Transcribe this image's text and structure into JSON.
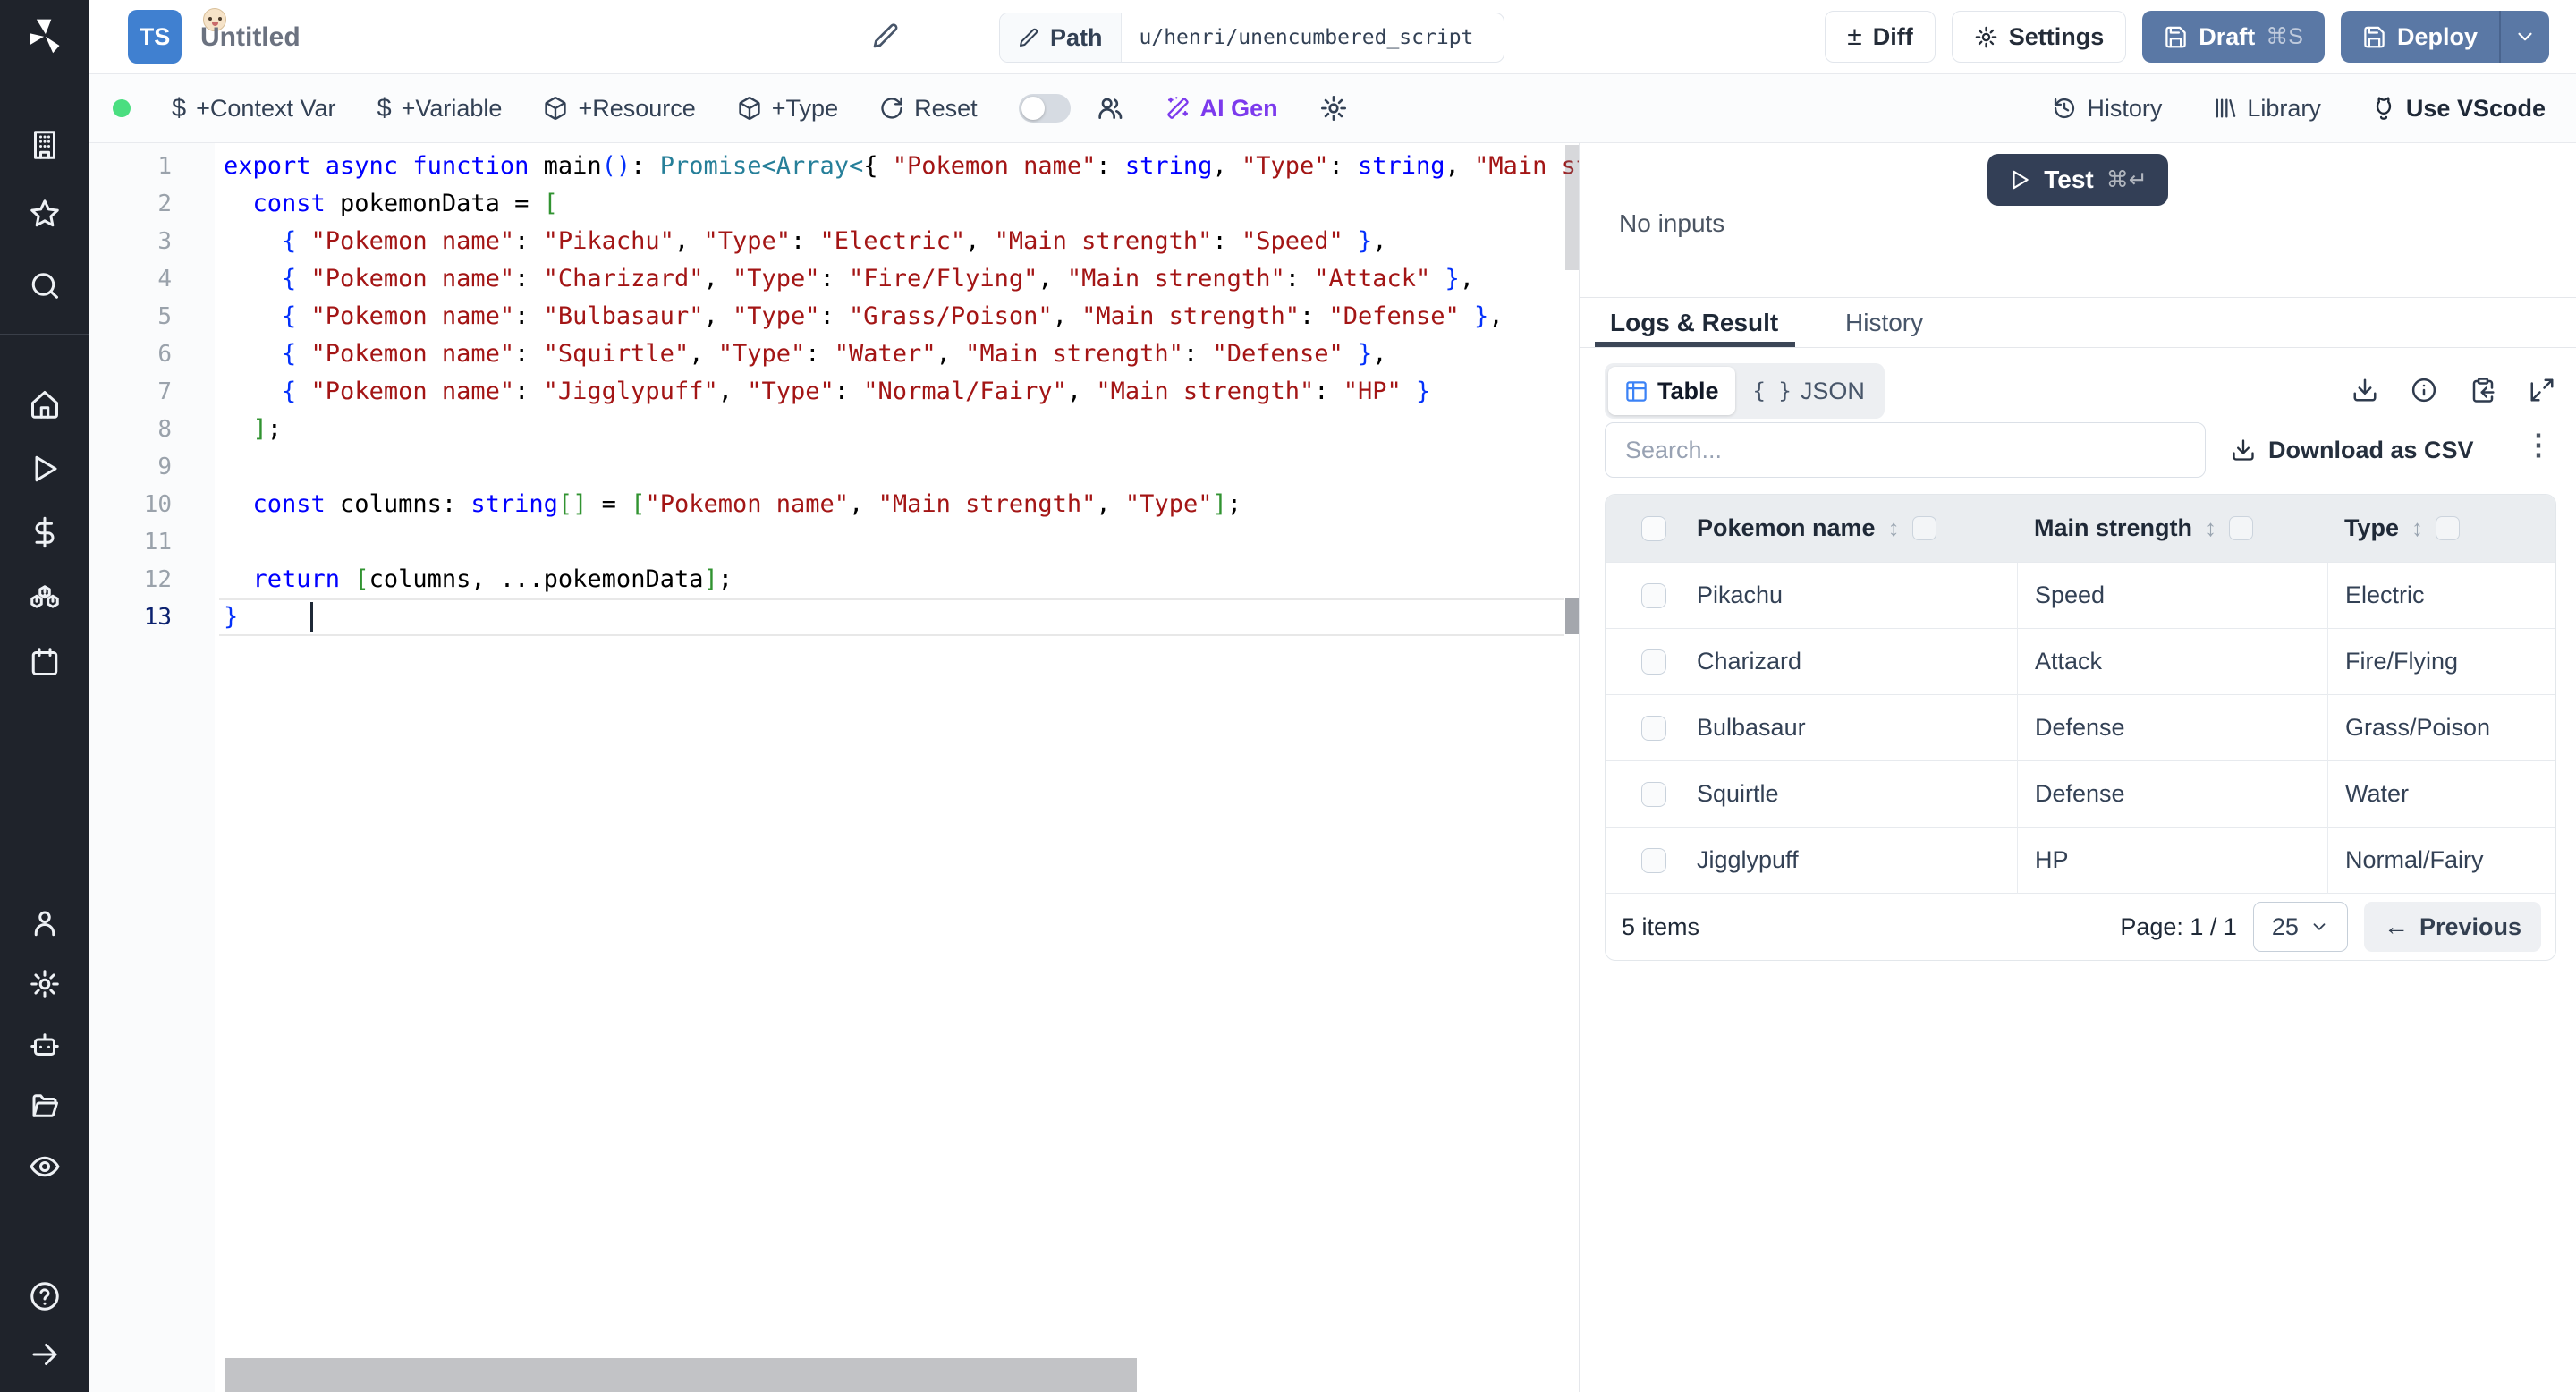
{
  "header": {
    "file_type": "TS",
    "title": "Untitled",
    "path_label": "Path",
    "path_value": "u/henri/unencumbered_script",
    "diff_label": "Diff",
    "settings_label": "Settings",
    "draft_label": "Draft",
    "draft_kbd": "⌘S",
    "deploy_label": "Deploy"
  },
  "toolbar": {
    "context_var": "+Context Var",
    "variable": "+Variable",
    "resource": "+Resource",
    "type": "+Type",
    "reset": "Reset",
    "ai_gen": "AI Gen",
    "history": "History",
    "library": "Library",
    "vscode": "Use VScode"
  },
  "icons": {
    "diff": "±",
    "dollar": "$",
    "sort": "↕",
    "kebab": "⋮",
    "prev_arrow": "←",
    "braces": "{ }",
    "help": "?"
  },
  "runner": {
    "test_label": "Test",
    "test_kbd": "⌘↵",
    "no_inputs": "No inputs"
  },
  "result": {
    "tabs": [
      "Logs & Result",
      "History"
    ],
    "view_table": "Table",
    "view_json": "JSON",
    "search_placeholder": "Search...",
    "download_csv": "Download as CSV",
    "table": {
      "columns": [
        "Pokemon name",
        "Main strength",
        "Type"
      ],
      "rows": [
        [
          "Pikachu",
          "Speed",
          "Electric"
        ],
        [
          "Charizard",
          "Attack",
          "Fire/Flying"
        ],
        [
          "Bulbasaur",
          "Defense",
          "Grass/Poison"
        ],
        [
          "Squirtle",
          "Defense",
          "Water"
        ],
        [
          "Jigglypuff",
          "HP",
          "Normal/Fairy"
        ]
      ]
    },
    "footer": {
      "items": "5 items",
      "page": "Page: 1 / 1",
      "page_size": "25",
      "previous": "Previous"
    }
  },
  "editor": {
    "lines": [
      [
        [
          "k",
          "export async function "
        ],
        [
          "p",
          "main"
        ],
        [
          "b1",
          "()"
        ],
        [
          "p",
          ": "
        ],
        [
          "t",
          "Promise<Array<"
        ],
        [
          "p",
          "{ "
        ],
        [
          "s",
          "\"Pokemon name\""
        ],
        [
          "p",
          ": "
        ],
        [
          "k",
          "string"
        ],
        [
          "p",
          ", "
        ],
        [
          "s",
          "\"Type\""
        ],
        [
          "p",
          ": "
        ],
        [
          "k",
          "string"
        ],
        [
          "p",
          ", "
        ],
        [
          "s",
          "\"Main st"
        ]
      ],
      [
        [
          "p",
          "  "
        ],
        [
          "k",
          "const"
        ],
        [
          "p",
          " pokemonData = "
        ],
        [
          "b2",
          "["
        ]
      ],
      [
        [
          "p",
          "    "
        ],
        [
          "b1",
          "{ "
        ],
        [
          "s",
          "\"Pokemon name\""
        ],
        [
          "p",
          ": "
        ],
        [
          "s",
          "\"Pikachu\""
        ],
        [
          "p",
          ", "
        ],
        [
          "s",
          "\"Type\""
        ],
        [
          "p",
          ": "
        ],
        [
          "s",
          "\"Electric\""
        ],
        [
          "p",
          ", "
        ],
        [
          "s",
          "\"Main strength\""
        ],
        [
          "p",
          ": "
        ],
        [
          "s",
          "\"Speed\""
        ],
        [
          "b1",
          " }"
        ],
        [
          "p",
          ","
        ]
      ],
      [
        [
          "p",
          "    "
        ],
        [
          "b1",
          "{ "
        ],
        [
          "s",
          "\"Pokemon name\""
        ],
        [
          "p",
          ": "
        ],
        [
          "s",
          "\"Charizard\""
        ],
        [
          "p",
          ", "
        ],
        [
          "s",
          "\"Type\""
        ],
        [
          "p",
          ": "
        ],
        [
          "s",
          "\"Fire/Flying\""
        ],
        [
          "p",
          ", "
        ],
        [
          "s",
          "\"Main strength\""
        ],
        [
          "p",
          ": "
        ],
        [
          "s",
          "\"Attack\""
        ],
        [
          "b1",
          " }"
        ],
        [
          "p",
          ","
        ]
      ],
      [
        [
          "p",
          "    "
        ],
        [
          "b1",
          "{ "
        ],
        [
          "s",
          "\"Pokemon name\""
        ],
        [
          "p",
          ": "
        ],
        [
          "s",
          "\"Bulbasaur\""
        ],
        [
          "p",
          ", "
        ],
        [
          "s",
          "\"Type\""
        ],
        [
          "p",
          ": "
        ],
        [
          "s",
          "\"Grass/Poison\""
        ],
        [
          "p",
          ", "
        ],
        [
          "s",
          "\"Main strength\""
        ],
        [
          "p",
          ": "
        ],
        [
          "s",
          "\"Defense\""
        ],
        [
          "b1",
          " }"
        ],
        [
          "p",
          ","
        ]
      ],
      [
        [
          "p",
          "    "
        ],
        [
          "b1",
          "{ "
        ],
        [
          "s",
          "\"Pokemon name\""
        ],
        [
          "p",
          ": "
        ],
        [
          "s",
          "\"Squirtle\""
        ],
        [
          "p",
          ", "
        ],
        [
          "s",
          "\"Type\""
        ],
        [
          "p",
          ": "
        ],
        [
          "s",
          "\"Water\""
        ],
        [
          "p",
          ", "
        ],
        [
          "s",
          "\"Main strength\""
        ],
        [
          "p",
          ": "
        ],
        [
          "s",
          "\"Defense\""
        ],
        [
          "b1",
          " }"
        ],
        [
          "p",
          ","
        ]
      ],
      [
        [
          "p",
          "    "
        ],
        [
          "b1",
          "{ "
        ],
        [
          "s",
          "\"Pokemon name\""
        ],
        [
          "p",
          ": "
        ],
        [
          "s",
          "\"Jigglypuff\""
        ],
        [
          "p",
          ", "
        ],
        [
          "s",
          "\"Type\""
        ],
        [
          "p",
          ": "
        ],
        [
          "s",
          "\"Normal/Fairy\""
        ],
        [
          "p",
          ", "
        ],
        [
          "s",
          "\"Main strength\""
        ],
        [
          "p",
          ": "
        ],
        [
          "s",
          "\"HP\""
        ],
        [
          "b1",
          " }"
        ]
      ],
      [
        [
          "p",
          "  "
        ],
        [
          "b2",
          "]"
        ],
        [
          "p",
          ";"
        ]
      ],
      [],
      [
        [
          "p",
          "  "
        ],
        [
          "k",
          "const"
        ],
        [
          "p",
          " columns: "
        ],
        [
          "k",
          "string"
        ],
        [
          "b2",
          "[]"
        ],
        [
          "p",
          " = "
        ],
        [
          "b2",
          "["
        ],
        [
          "s",
          "\"Pokemon name\""
        ],
        [
          "p",
          ", "
        ],
        [
          "s",
          "\"Main strength\""
        ],
        [
          "p",
          ", "
        ],
        [
          "s",
          "\"Type\""
        ],
        [
          "b2",
          "]"
        ],
        [
          "p",
          ";"
        ]
      ],
      [],
      [
        [
          "p",
          "  "
        ],
        [
          "k",
          "return"
        ],
        [
          "p",
          " "
        ],
        [
          "b2",
          "["
        ],
        [
          "p",
          "columns, ...pokemonData"
        ],
        [
          "b2",
          "]"
        ],
        [
          "p",
          ";"
        ]
      ],
      [
        [
          "b1",
          "}"
        ]
      ]
    ],
    "active_line": 13
  },
  "colors": {
    "steel_button": "#5a78a5",
    "test_button": "#333f56",
    "ai_purple": "#7c3aed",
    "table_icon_blue": "#3b82f6",
    "status_green": "#4ade80",
    "rail_bg": "#1f232b"
  }
}
